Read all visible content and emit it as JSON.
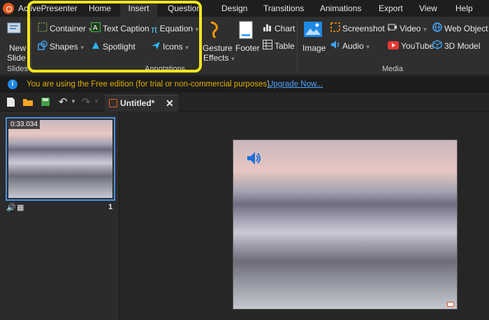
{
  "app": {
    "name": "ActivePresenter"
  },
  "menu": [
    "Home",
    "Insert",
    "Question",
    "Design",
    "Transitions",
    "Animations",
    "Export",
    "View",
    "Help"
  ],
  "menu_active": "Insert",
  "ribbon": {
    "new_slide": {
      "line1": "New",
      "line2": "Slide"
    },
    "slides_group": "Slides",
    "annotations": {
      "container": "Container",
      "text_caption": "Text Caption",
      "equation": "Equation",
      "shapes": "Shapes",
      "spotlight": "Spotlight",
      "icons": "Icons",
      "group_label": "Annotations"
    },
    "gesture": {
      "line1": "Gesture",
      "line2": "Effects"
    },
    "footer": "Footer",
    "chart": "Chart",
    "table": "Table",
    "media": {
      "image": "Image",
      "screenshot": "Screenshot",
      "audio": "Audio",
      "video": "Video",
      "youtube": "YouTube",
      "web_object": "Web Object",
      "model_3d": "3D Model",
      "group_label": "Media"
    }
  },
  "infobar": {
    "message": "You are using the Free edition (for trial or non-commercial purposes).",
    "link": "Upgrade Now..."
  },
  "tab": {
    "title": "Untitled*"
  },
  "slide": {
    "duration": "0:33.034",
    "number": "1"
  },
  "colors": {
    "highlight": "#f3e61a",
    "accent": "#1e88e5",
    "info_text": "#e0b000"
  }
}
